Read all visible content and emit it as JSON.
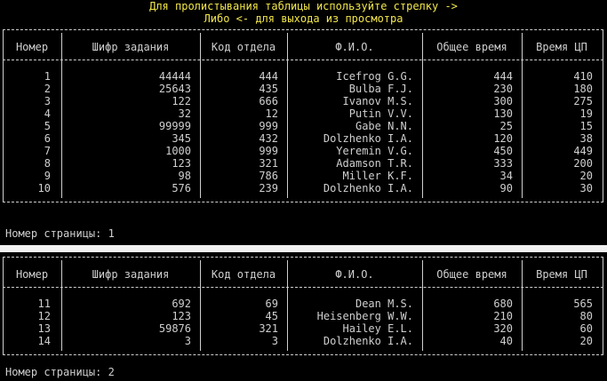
{
  "hint": {
    "line1": "Для пролистывания таблицы используйте стрелку ->",
    "line2": "Либо <- для выхода из просмотра"
  },
  "columns": [
    "Номер",
    "Шифр задания",
    "Код отдела",
    "Ф.И.О.",
    "Общее время",
    "Время ЦП"
  ],
  "page1": {
    "label": "Номер страницы: 1",
    "rows": [
      [
        "1",
        "44444",
        "444",
        "Icefrog G.G.",
        "444",
        "410"
      ],
      [
        "2",
        "25643",
        "435",
        "Bulba F.J.",
        "230",
        "180"
      ],
      [
        "3",
        "122",
        "666",
        "Ivanov M.S.",
        "300",
        "275"
      ],
      [
        "4",
        "32",
        "12",
        "Putin V.V.",
        "130",
        "19"
      ],
      [
        "5",
        "99999",
        "999",
        "Gabe N.N.",
        "25",
        "15"
      ],
      [
        "6",
        "345",
        "432",
        "Dolzhenko I.A.",
        "120",
        "38"
      ],
      [
        "7",
        "1000",
        "999",
        "Yeremin V.G.",
        "450",
        "449"
      ],
      [
        "8",
        "123",
        "321",
        "Adamson T.R.",
        "333",
        "200"
      ],
      [
        "9",
        "98",
        "786",
        "Miller K.F.",
        "34",
        "20"
      ],
      [
        "10",
        "576",
        "239",
        "Dolzhenko I.A.",
        "90",
        "30"
      ]
    ]
  },
  "page2": {
    "label": "Номер страницы: 2",
    "rows": [
      [
        "11",
        "692",
        "69",
        "Dean M.S.",
        "680",
        "565"
      ],
      [
        "12",
        "123",
        "45",
        "Heisenberg W.W.",
        "210",
        "80"
      ],
      [
        "13",
        "59876",
        "321",
        "Hailey E.L.",
        "320",
        "60"
      ],
      [
        "14",
        "3",
        "3",
        "Dolzhenko I.A.",
        "40",
        "20"
      ]
    ]
  }
}
